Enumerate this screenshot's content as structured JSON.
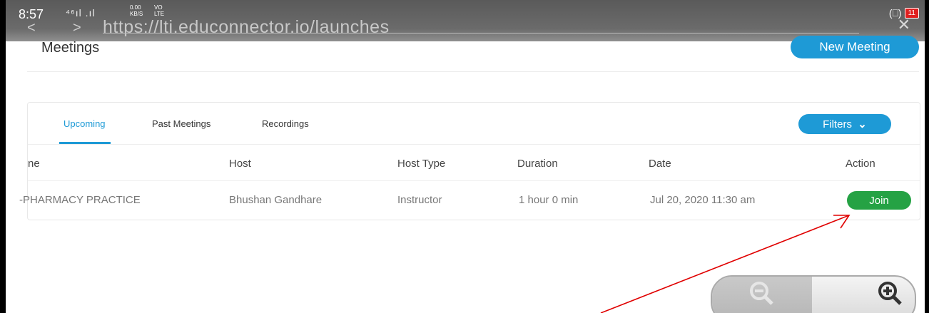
{
  "status": {
    "time": "8:57",
    "signal": "⁴⁶ıl .ıl",
    "net_speed_value": "0.00",
    "net_speed_unit": "KB/S",
    "volte_top": "VO",
    "volte_bottom": "LTE",
    "battery": "11",
    "vibrate_icon": "(⎕)"
  },
  "browser": {
    "url": "https://lti.educonnector.io/launches",
    "back_glyph": "<",
    "forward_glyph": ">",
    "close_glyph": "✕"
  },
  "page": {
    "title": "Meetings",
    "new_meeting_label": "New Meeting"
  },
  "tabs": [
    {
      "label": "Upcoming",
      "active": true
    },
    {
      "label": "Past Meetings",
      "active": false
    },
    {
      "label": "Recordings",
      "active": false
    }
  ],
  "filters_label": "Filters",
  "filters_chevron": "⌄",
  "table": {
    "headers": [
      "ne",
      "Host",
      "Host Type",
      "Duration",
      "Date",
      "Action"
    ],
    "rows": [
      {
        "topic": "-PHARMACY PRACTICE",
        "host": "Bhushan Gandhare",
        "host_type": "Instructor",
        "duration": "1 hour 0 min",
        "date": "Jul 20, 2020 11:30 am",
        "action": "Join"
      }
    ]
  },
  "colors": {
    "accent": "#1e9ad6",
    "join": "#25a244",
    "annotation_arrow": "#e00000"
  },
  "icons": {
    "zoom_out": "zoom-out-icon",
    "zoom_in": "zoom-in-icon"
  }
}
